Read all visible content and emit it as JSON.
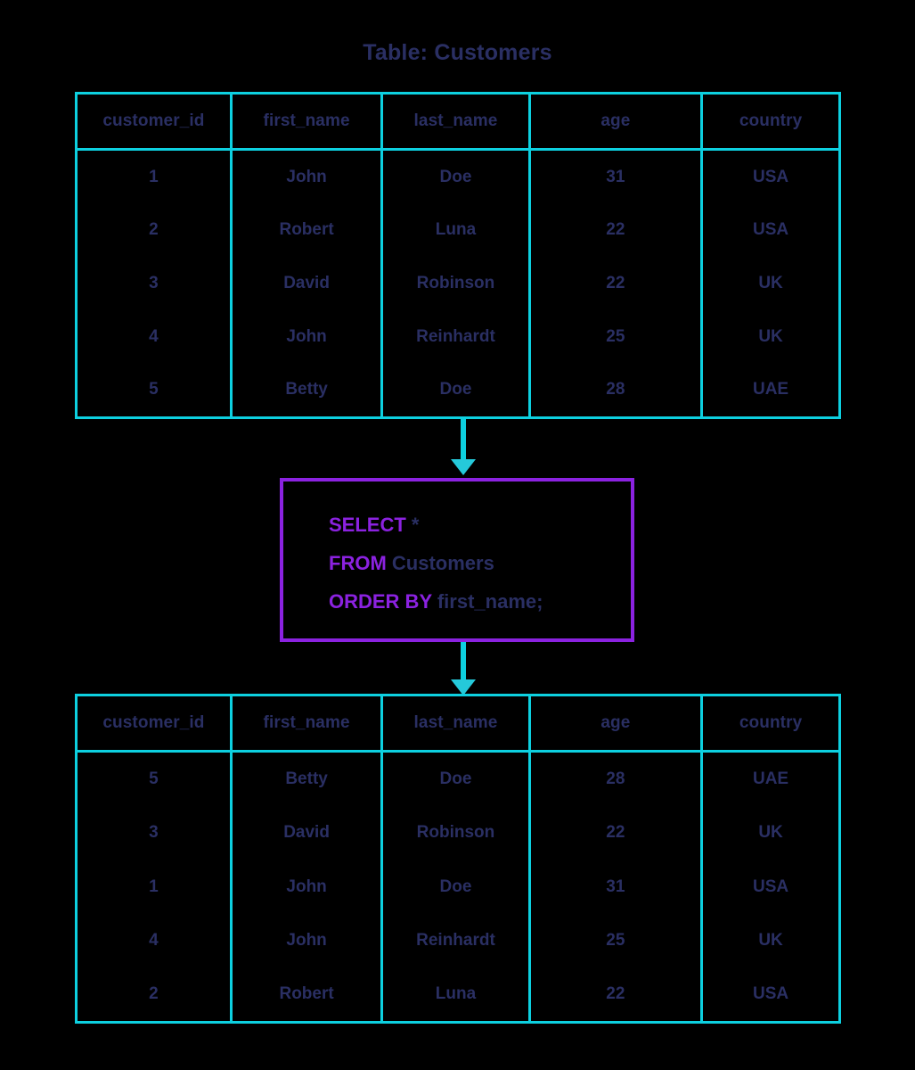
{
  "title": "Table: Customers",
  "colors": {
    "background": "#000000",
    "table_border": "#0dd0e0",
    "text": "#2a2f63",
    "keyword": "#8b22e0",
    "query_box_border": "#8b22e0",
    "arrow": "#0dd0e0"
  },
  "columns": [
    {
      "key": "customer_id",
      "label": "customer_id"
    },
    {
      "key": "first_name",
      "label": "first_name"
    },
    {
      "key": "last_name",
      "label": "last_name"
    },
    {
      "key": "age",
      "label": "age"
    },
    {
      "key": "country",
      "label": "country"
    }
  ],
  "source_table": {
    "rows": [
      {
        "customer_id": "1",
        "first_name": "John",
        "last_name": "Doe",
        "age": "31",
        "country": "USA"
      },
      {
        "customer_id": "2",
        "first_name": "Robert",
        "last_name": "Luna",
        "age": "22",
        "country": "USA"
      },
      {
        "customer_id": "3",
        "first_name": "David",
        "last_name": "Robinson",
        "age": "22",
        "country": "UK"
      },
      {
        "customer_id": "4",
        "first_name": "John",
        "last_name": "Reinhardt",
        "age": "25",
        "country": "UK"
      },
      {
        "customer_id": "5",
        "first_name": "Betty",
        "last_name": "Doe",
        "age": "28",
        "country": "UAE"
      }
    ]
  },
  "result_table": {
    "rows": [
      {
        "customer_id": "5",
        "first_name": "Betty",
        "last_name": "Doe",
        "age": "28",
        "country": "UAE"
      },
      {
        "customer_id": "3",
        "first_name": "David",
        "last_name": "Robinson",
        "age": "22",
        "country": "UK"
      },
      {
        "customer_id": "1",
        "first_name": "John",
        "last_name": "Doe",
        "age": "31",
        "country": "USA"
      },
      {
        "customer_id": "4",
        "first_name": "John",
        "last_name": "Reinhardt",
        "age": "25",
        "country": "UK"
      },
      {
        "customer_id": "2",
        "first_name": "Robert",
        "last_name": "Luna",
        "age": "22",
        "country": "USA"
      }
    ]
  },
  "query": {
    "line1_keyword": "SELECT",
    "line1_operand": "*",
    "line2_keyword": "FROM",
    "line2_operand": "Customers",
    "line3_keyword": "ORDER BY",
    "line3_operand": "first_name;"
  }
}
